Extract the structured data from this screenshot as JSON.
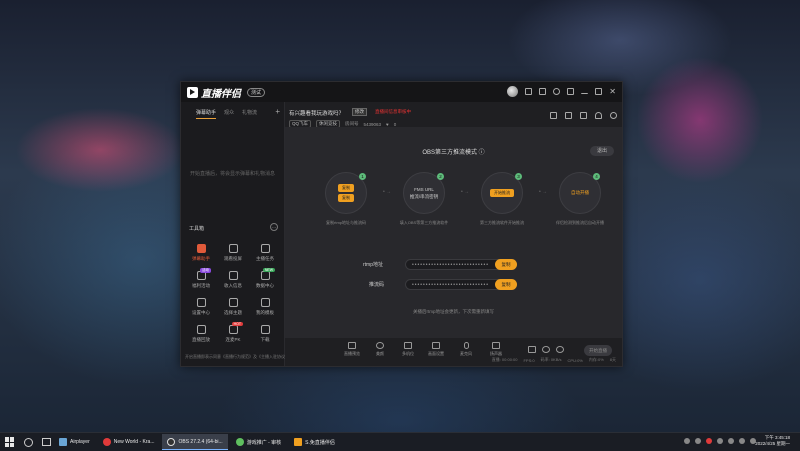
{
  "app": {
    "name": "直播伴侣",
    "version_badge": "测试"
  },
  "sidebar": {
    "tabs": [
      "弹幕助手",
      "观众",
      "礼物流"
    ],
    "empty_text": "开始直播后，将会显示弹幕和礼物消息",
    "tools_title": "工具箱",
    "tools": [
      {
        "label": "弹幕助手",
        "active": true
      },
      {
        "label": "观看投屏"
      },
      {
        "label": "主播任务"
      },
      {
        "label": "福利活动",
        "badge": "活动"
      },
      {
        "label": "收入信息"
      },
      {
        "label": "数据中心",
        "badge": "NEW"
      },
      {
        "label": "设置中心"
      },
      {
        "label": "选择主题"
      },
      {
        "label": "我的模板"
      },
      {
        "label": "直播回放"
      },
      {
        "label": "连麦PK",
        "badge": "HOT"
      },
      {
        "label": "下载"
      }
    ],
    "footer": "开启直播即表示同意《直播行为规范》及《主播入驻协议》"
  },
  "room": {
    "title": "有兴趣看我玩游戏吗？",
    "edit_label": "修改",
    "red_text": "直播间信息审核中",
    "category": "QQ飞车",
    "tag": "休闲竞技",
    "id_label": "房间号",
    "id_value": "5439063",
    "likes": "0"
  },
  "obs": {
    "title": "OBS第三方推流模式",
    "help": "?",
    "exit": "退出",
    "steps": [
      {
        "num": "1",
        "btn1": "复制",
        "btn2": "复制",
        "desc": "复制rtmp地址与推流码"
      },
      {
        "num": "2",
        "line1": "FMS URL",
        "line2": "推流/串流密钥",
        "desc": "填入OBS等第三方推流软件"
      },
      {
        "num": "3",
        "btn": "开始推流",
        "desc": "第三方推流软件开始推流"
      },
      {
        "num": "4",
        "text": "自动开播",
        "desc": "伴侣检测到推流后自动开播"
      }
    ],
    "rtmp_label": "rtmp地址",
    "rtmp_value": "••••••••••••••••••••••••••••",
    "key_label": "推流码",
    "key_value": "••••••••••••••••••••••••••••",
    "copy_label": "复制",
    "hint": "关播后rtmp地址会更新，下次需重新填写"
  },
  "toolbar": {
    "buttons": [
      "直播预览",
      "美颜",
      "多机位",
      "画面设置",
      "麦克风",
      "扬声器"
    ],
    "live_label": "开始直播"
  },
  "status": [
    "直播: 00:00:00",
    "FPS:0",
    "码率: 0KB/s",
    "CPU:0%",
    "内存:0%",
    "8天"
  ],
  "taskbar": {
    "tasks": [
      {
        "label": "Airplayer",
        "color": "#6aa6d6"
      },
      {
        "label": "New World - Kra...",
        "color": "#e03a3a"
      },
      {
        "label": "OBS 27.2.4 (64-bi...",
        "color": "#333333",
        "active": true
      },
      {
        "label": "游戏推广 - 审核",
        "color": "#5fbf5f"
      },
      {
        "label": "S.免直播伴侣",
        "color": "#f0a020"
      }
    ],
    "time": "下午 3:45:18",
    "date": "2022/4/25 星期一"
  }
}
